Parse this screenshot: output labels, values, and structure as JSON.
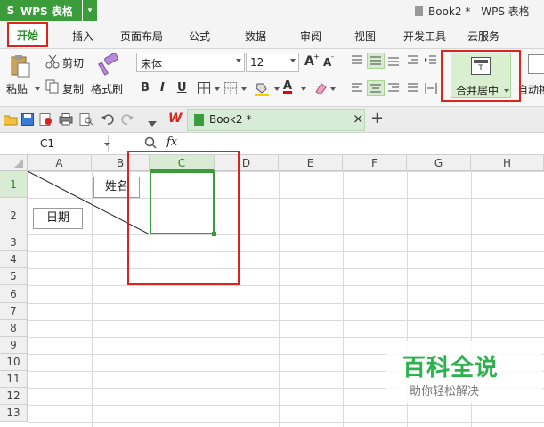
{
  "app": {
    "name": "WPS 表格",
    "window_title": "Book2 * - WPS 表格",
    "logo_glyph": "S",
    "dropdown_glyph": "▾"
  },
  "menu": {
    "items": [
      "开始",
      "插入",
      "页面布局",
      "公式",
      "数据",
      "审阅",
      "视图",
      "开发工具",
      "云服务"
    ],
    "active": "开始",
    "active_color": "#2d8d2d"
  },
  "ribbon": {
    "paste_label": "粘贴",
    "cut_label": "剪切",
    "copy_label": "复制",
    "format_painter_label": "格式刷",
    "font_name": "宋体",
    "font_size": "12",
    "bold_glyph": "B",
    "italic_glyph": "I",
    "underline_glyph": "U",
    "merge_center_label": "合并居中",
    "auto_wrap_label": "自动换",
    "grow_font_glyph": "A",
    "shrink_font_glyph": "A",
    "font_color_glyph": "A"
  },
  "tabs": {
    "doc_tab_label": "Book2 *",
    "close_glyph": "×",
    "add_glyph": "+",
    "wps_glyph": "W"
  },
  "formula_bar": {
    "cell_ref": "C1",
    "fx_label": "fx",
    "formula": ""
  },
  "sheet": {
    "columns": [
      "A",
      "B",
      "C",
      "D",
      "E",
      "F",
      "G",
      "H"
    ],
    "rows": [
      "1",
      "2",
      "3",
      "4",
      "5",
      "6",
      "7",
      "8",
      "9",
      "10",
      "11",
      "12",
      "13"
    ],
    "selected_cell": "C1",
    "header_text": {
      "name": "姓名",
      "date": "日期"
    }
  },
  "watermark": {
    "title": "百科全说",
    "subtitle": "助你轻松解决"
  },
  "colors": {
    "accent_green": "#3b9c3b",
    "highlight_red": "#d9251e",
    "selection_green": "#3c9a3c"
  }
}
